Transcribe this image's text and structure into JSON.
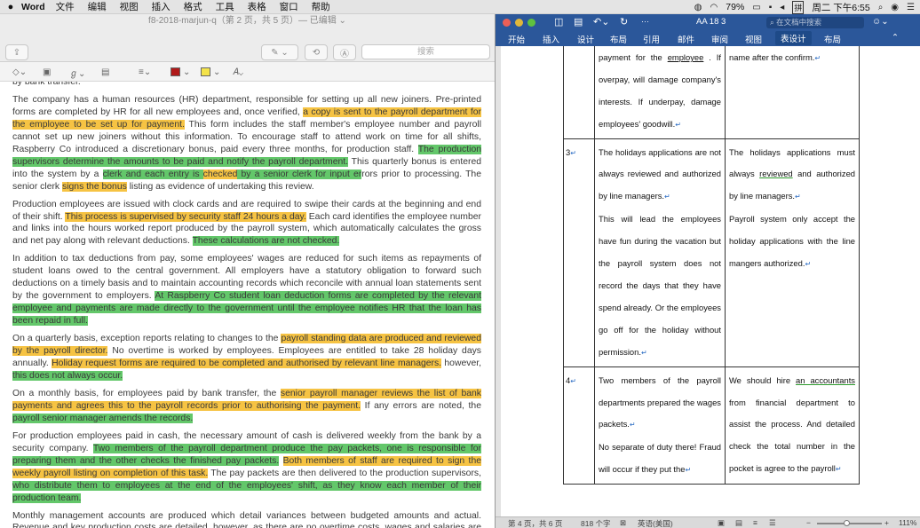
{
  "menubar": {
    "app_name": "Word",
    "items": [
      "文件",
      "编辑",
      "视图",
      "插入",
      "格式",
      "工具",
      "表格",
      "窗口",
      "帮助"
    ],
    "battery": "79%",
    "ime": "拼",
    "datetime": "周二 下午6:55"
  },
  "preview": {
    "window_title": "f8-2018-marjun-q（第 2 页，共 5 页）— 已编辑 ⌄",
    "search_placeholder": "搜索",
    "highlight_colors": {
      "yellow": "#f6c343",
      "green": "#63c76a"
    },
    "paragraphs": [
      [
        {
          "t": "by bank transfer."
        }
      ],
      [
        {
          "t": "The company has a human resources (HR) department, responsible for setting up all new joiners. Pre-printed forms are completed by HR for all new employees and, once verified, "
        },
        {
          "t": "a copy is sent to the payroll department for the employee to be set up for payment.",
          "h": "y"
        },
        {
          "t": " This form includes the staff member's employee number and payroll cannot set up new joiners without this information. To encourage staff to attend work on time for all shifts, Raspberry Co introduced a discretionary bonus, paid every three months, for production staff. "
        },
        {
          "t": "The production supervisors determine the amounts to be paid and notify the payroll department.",
          "h": "g"
        },
        {
          "t": " This quarterly bonus is entered into the system by a "
        },
        {
          "t": "clerk and each entry is ",
          "h": "g"
        },
        {
          "t": "checked",
          "h": "y"
        },
        {
          "t": " by a senior clerk for input er",
          "h": "g"
        },
        {
          "t": "rors prior to processing. The senior clerk "
        },
        {
          "t": "signs the bonus",
          "h": "y"
        },
        {
          "t": " listing as evidence of undertaking this review."
        }
      ],
      [
        {
          "t": "Production employees are issued with clock cards and are required to swipe their cards at the beginning and end of their shift. "
        },
        {
          "t": "This process is supervised by security staff 24 hours a day.",
          "h": "y"
        },
        {
          "t": " Each card identifies the employee number and links into the hours worked report produced by the payroll system, which automatically calculates the gross and net pay along with relevant deductions. "
        },
        {
          "t": "These calculations are not checked.",
          "h": "g"
        }
      ],
      [
        {
          "t": "In addition to tax deductions from pay, some employees' wages are reduced for such items as repayments of student loans owed to the central government. All employers have a statutory obligation to forward such deductions on a timely basis and to maintain accounting records which reconcile with annual loan statements sent by the government to employers. "
        },
        {
          "t": "At Raspberry Co student loan deduction forms are completed by the relevant employee and payments are made directly to the government until the employee notifies HR that the loan has been repaid in full.",
          "h": "g"
        }
      ],
      [
        {
          "t": "On a quarterly basis, exception reports relating to changes to the "
        },
        {
          "t": "payroll standing data are produced and reviewed by the payroll director.",
          "h": "y"
        },
        {
          "t": " No overtime is worked by employees. Employees are entitled to take 28 holiday days annually. "
        },
        {
          "t": "Holiday request forms are required to be completed and authorised by relevant line managers.",
          "h": "y"
        },
        {
          "t": " however, "
        },
        {
          "t": "this does not always occur.",
          "h": "g"
        }
      ],
      [
        {
          "t": "On a monthly basis, for employees paid by bank transfer, the "
        },
        {
          "t": "senior payroll manager reviews the list of bank payments and agrees this to the payroll records prior to authorising the payment.",
          "h": "y"
        },
        {
          "t": " If any errors are noted, the "
        },
        {
          "t": "payroll senior manager amends the records.",
          "h": "g"
        }
      ],
      [
        {
          "t": "For production employees paid in cash, the necessary amount of cash is delivered weekly from the bank by a security company. "
        },
        {
          "t": "Two members of the payroll department produce the pay packets, one is responsible for preparing them and the other checks the finished pay packets.",
          "h": "g"
        },
        {
          "t": " "
        },
        {
          "t": "Both members of staff are required to sign the weekly payroll listing on completion of this task.",
          "h": "y"
        },
        {
          "t": " The pay packets are then delivered to the production supervisors, "
        },
        {
          "t": "who distribute them to employees at the end of the employees' shift, as they know each member of their production team.",
          "h": "g"
        }
      ],
      [
        {
          "t": "Monthly management accounts are produced which detail variances between budgeted amounts and actual. Revenue and key production costs are detailed, however, as there are no overtime costs, wages and salaries are not analysed."
        }
      ]
    ]
  },
  "word": {
    "font_size_label": "AA 18 3",
    "search_placeholder": "在文档中搜索",
    "tabs": [
      "开始",
      "插入",
      "设计",
      "布局",
      "引用",
      "邮件",
      "审阅",
      "视图",
      "表设计",
      "布局"
    ],
    "active_tab": "表设计",
    "status": {
      "page": "第 4 页，共 6 页",
      "words": "818 个字",
      "language": "英语(美国)",
      "zoom": "111%",
      "zoom_fraction": 0.45
    },
    "rows": [
      {
        "num": "",
        "weakness": [
          {
            "t": "The significant risk of wrong payment for the "
          },
          {
            "t": "employee",
            "u": "ul"
          },
          {
            "t": " . If overpay, will damage company's interests. If underpay, damage employees' goodwill."
          }
        ],
        "recommendation": [
          {
            "t": "And required the clerk sign his name after the confirm."
          }
        ]
      },
      {
        "num": "3",
        "weakness": [
          {
            "t": "The holidays applications are not always reviewed and authorized by line managers."
          },
          {
            "t": "\n"
          },
          {
            "t": "This will lead the employees have fun during the vacation but the payroll system does not record the days that they have spend already. Or the employees go off for the holiday without permission."
          }
        ],
        "recommendation": [
          {
            "t": "The holidays applications must always "
          },
          {
            "t": "reviewed",
            "u": "ulg"
          },
          {
            "t": " and authorized by line managers."
          },
          {
            "t": "\n"
          },
          {
            "t": "Payroll system only accept the holiday applications with the line mangers authorized."
          }
        ]
      },
      {
        "num": "4",
        "weakness": [
          {
            "t": "Two members of the payroll departments prepared the wages packets."
          },
          {
            "t": "\n"
          },
          {
            "t": "No separate of duty there! Fraud will occur if they put the"
          }
        ],
        "recommendation": [
          {
            "t": "We should hire "
          },
          {
            "t": "an accountants",
            "u": "ulg"
          },
          {
            "t": " from financial department to assist the process. And detailed check the total number in the pocket is agree to the payroll"
          }
        ]
      }
    ]
  }
}
